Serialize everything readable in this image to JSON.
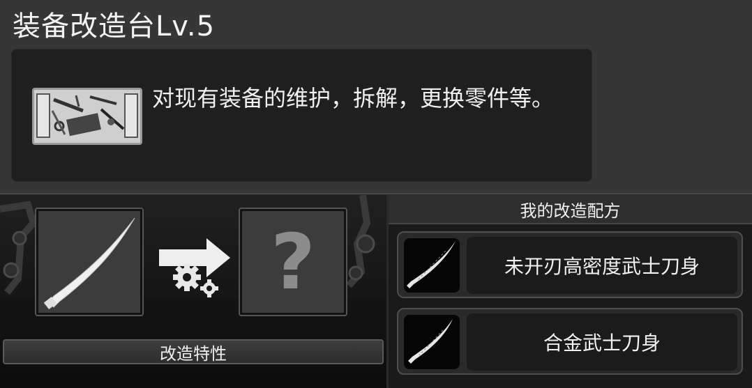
{
  "header": {
    "title": "装备改造台Lv.5"
  },
  "description": {
    "icon": "toolbox-icon",
    "text": "对现有装备的维护，拆解，更换零件等。"
  },
  "workbench": {
    "source_item_icon": "katana-blade-icon",
    "process_icon": "arrow-gears-icon",
    "result_placeholder": "?",
    "traits_label": "改造特性"
  },
  "recipes": {
    "header": "我的改造配方",
    "items": [
      {
        "name": "未开刃高密度武士刀身",
        "icon": "katana-blade-icon"
      },
      {
        "name": "合金武士刀身",
        "icon": "katana-blade-icon"
      }
    ]
  },
  "colors": {
    "background": "#2a2a2a",
    "panel": "#363636",
    "box": "#1f1f1f",
    "text": "#f2f2f2"
  }
}
